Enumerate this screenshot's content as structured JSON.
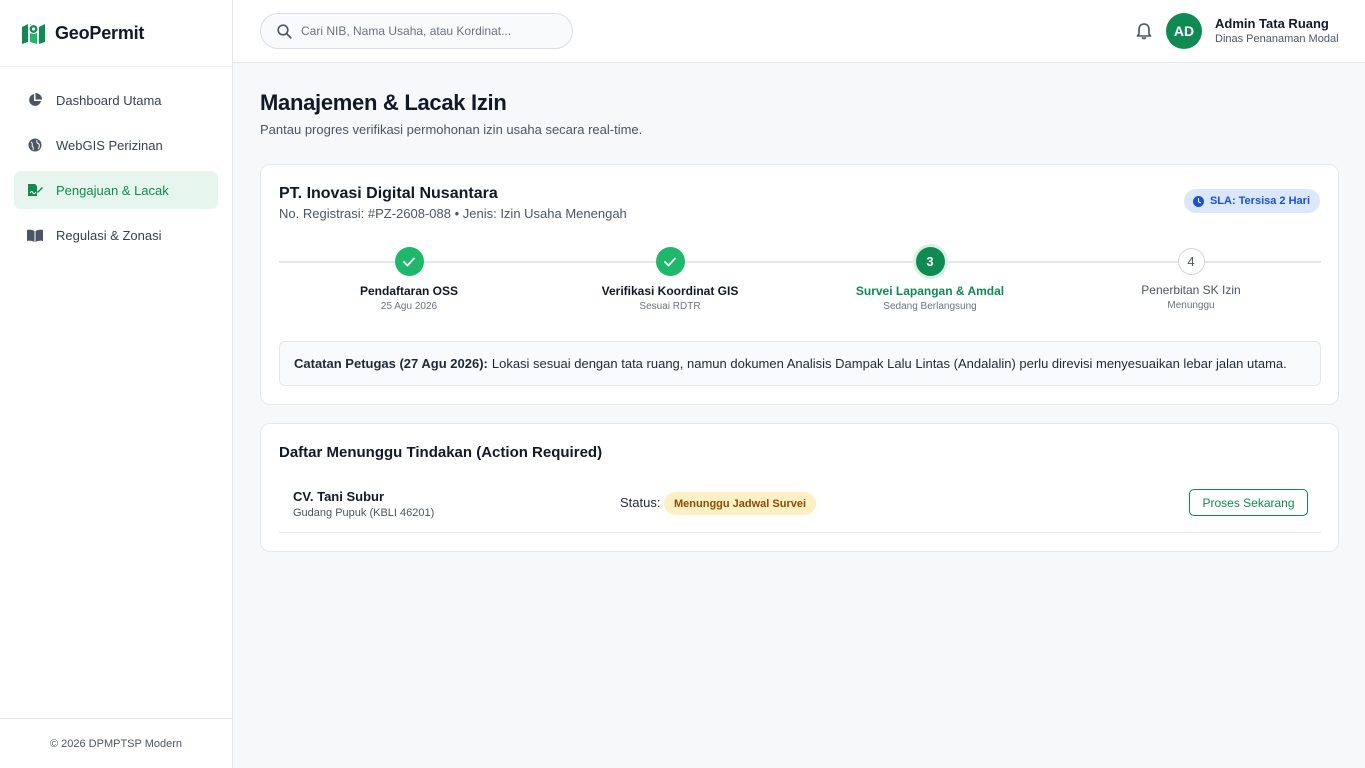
{
  "brand": {
    "name": "GeoPermit"
  },
  "sidebar": {
    "items": [
      {
        "label": "Dashboard Utama",
        "icon": "pie-chart-icon"
      },
      {
        "label": "WebGIS Perizinan",
        "icon": "globe-icon"
      },
      {
        "label": "Pengajuan & Lacak",
        "icon": "file-signature-icon",
        "active": true
      },
      {
        "label": "Regulasi & Zonasi",
        "icon": "book-icon"
      }
    ],
    "footer": "© 2026 DPMPTSP Modern"
  },
  "topbar": {
    "search_placeholder": "Cari NIB, Nama Usaha, atau Kordinat...",
    "avatar_initials": "AD",
    "user_name": "Admin Tata Ruang",
    "user_role": "Dinas Penanaman Modal"
  },
  "main": {
    "title": "Manajemen & Lacak Izin",
    "subtitle": "Pantau progres verifikasi permohonan izin usaha secara real-time."
  },
  "tracking_card": {
    "company": "PT. Inovasi Digital Nusantara",
    "registration": "No. Registrasi: #PZ-2608-088 • Jenis: Izin Usaha Menengah",
    "sla": "SLA: Tersisa 2 Hari",
    "steps": [
      {
        "number": "1",
        "label": "Pendaftaran OSS",
        "sub": "25 Agu 2026",
        "state": "done"
      },
      {
        "number": "2",
        "label": "Verifikasi Koordinat GIS",
        "sub": "Sesuai RDTR",
        "state": "done"
      },
      {
        "number": "3",
        "label": "Survei Lapangan & Amdal",
        "sub": "Sedang Berlangsung",
        "state": "current"
      },
      {
        "number": "4",
        "label": "Penerbitan SK Izin",
        "sub": "Menunggu",
        "state": "pending"
      }
    ],
    "note_label": "Catatan Petugas (27 Agu 2026):",
    "note_text": "Lokasi sesuai dengan tata ruang, namun dokumen Analisis Dampak Lalu Lintas (Andalalin) perlu direvisi menyesuaikan lebar jalan utama."
  },
  "action_card": {
    "title": "Daftar Menunggu Tindakan (Action Required)",
    "rows": [
      {
        "name": "CV. Tani Subur",
        "sub": "Gudang Pupuk (KBLI 46201)",
        "status_label": "Status:",
        "status": "Menunggu Jadwal Survei",
        "action": "Proses Sekarang"
      }
    ]
  },
  "colors": {
    "accent": "#0f8a52",
    "accent_light": "#e6f6ee",
    "sla_bg": "#dbe7fb",
    "sla_text": "#1d4ed8",
    "badge_bg": "#fdf0c4",
    "badge_text": "#8a4b06"
  }
}
